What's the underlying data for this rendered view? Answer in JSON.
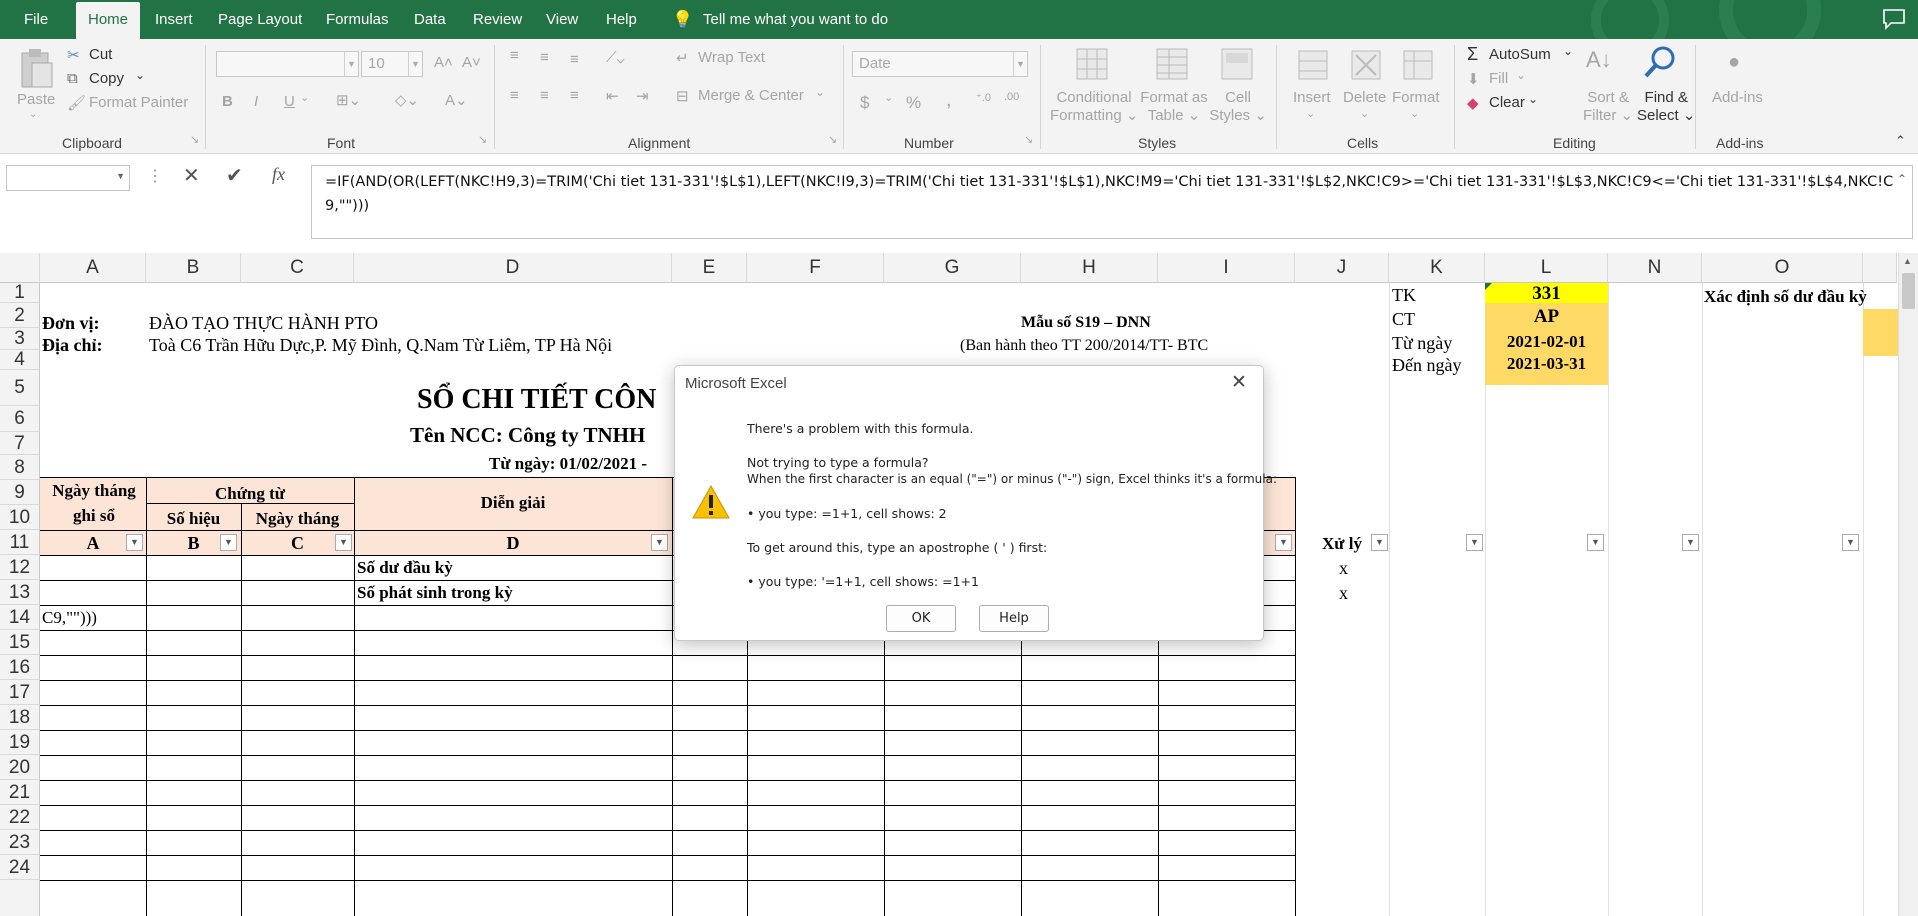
{
  "menu": {
    "tabs": [
      "File",
      "Home",
      "Insert",
      "Page Layout",
      "Formulas",
      "Data",
      "Review",
      "View",
      "Help"
    ],
    "tell_me": "Tell me what you want to do"
  },
  "ribbon": {
    "clipboard": {
      "paste": "Paste",
      "cut": "Cut",
      "copy": "Copy",
      "format_painter": "Format Painter",
      "group": "Clipboard"
    },
    "font": {
      "size": "10",
      "bold": "B",
      "italic": "I",
      "underline": "U",
      "group": "Font"
    },
    "alignment": {
      "wrap": "Wrap Text",
      "merge": "Merge & Center",
      "group": "Alignment"
    },
    "number": {
      "format": "Date",
      "currency": "$",
      "percent": "%",
      "comma": ",",
      "group": "Number"
    },
    "styles": {
      "conditional_1": "Conditional",
      "conditional_2": "Formatting",
      "format_as_1": "Format as",
      "format_as_2": "Table",
      "cell_styles_1": "Cell",
      "cell_styles_2": "Styles",
      "group": "Styles"
    },
    "cells": {
      "insert": "Insert",
      "delete": "Delete",
      "format": "Format",
      "group": "Cells"
    },
    "editing": {
      "autosum": "AutoSum",
      "fill": "Fill",
      "clear": "Clear",
      "sort_1": "Sort &",
      "sort_2": "Filter",
      "find_1": "Find &",
      "find_2": "Select",
      "group": "Editing"
    },
    "addins": {
      "label": "Add-ins",
      "group": "Add-ins"
    }
  },
  "formula_bar": {
    "name_box": "",
    "fx": "fx",
    "formula": "=IF(AND(OR(LEFT(NKC!H9,3)=TRIM('Chi tiet 131-331'!$L$1),LEFT(NKC!I9,3)=TRIM('Chi tiet 131-331'!$L$1),NKC!M9='Chi tiet 131-331'!$L$2,NKC!C9>='Chi tiet 131-331'!$L$3,NKC!C9<='Chi tiet 131-331'!$L$4,NKC!C9,\"\")))"
  },
  "grid": {
    "columns": [
      "A",
      "B",
      "C",
      "D",
      "E",
      "F",
      "G",
      "H",
      "I",
      "J",
      "K",
      "L",
      "N",
      "O"
    ],
    "rows": [
      "1",
      "2",
      "3",
      "4",
      "5",
      "6",
      "7",
      "8",
      "9",
      "10",
      "11",
      "12",
      "13",
      "14",
      "15",
      "16",
      "17",
      "18",
      "19",
      "20",
      "21",
      "22",
      "23",
      "24"
    ],
    "cells": {
      "don_vi_label": "Đơn vị:",
      "don_vi": "ĐÀO TẠO THỰC HÀNH PTO",
      "dia_chi_label": "Địa chỉ:",
      "dia_chi": "Toà C6 Trần Hữu Dực,P. Mỹ Đình, Q.Nam Từ Liêm, TP Hà Nội",
      "mau_so": "Mẫu số S19 – DNN",
      "ban_hanh": "(Ban hành theo TT 200/2014/TT- BTC",
      "title": "SỔ CHI TIẾT CÔN",
      "ncc": "Tên NCC: Công ty TNHH",
      "tu_ngay_line": "Từ ngày: 01/02/2021 -",
      "hdr_ngay_1": "Ngày tháng",
      "hdr_ngay_2": "ghi sổ",
      "hdr_chung_tu": "Chứng từ",
      "hdr_so_hieu": "Số hiệu",
      "hdr_ngay_thang": "Ngày tháng",
      "hdr_dien_giai": "Diễn giải",
      "colA": "A",
      "colB": "B",
      "colC": "C",
      "colD": "D",
      "so_du": "Số dư đầu kỳ",
      "so_phat_sinh": "Số phát sinh trong kỳ",
      "a13": "C9,\"\")))",
      "xu_ly": "Xử lý",
      "x1": "x",
      "x2": "x",
      "tk_label": "TK",
      "tk_value": "331",
      "ct_label": "CT",
      "ct_value": "AP",
      "tu_ngay_label": "Từ ngày",
      "tu_ngay_value": "2021-02-01",
      "den_ngay_label": "Đến ngày",
      "den_ngay_value": "2021-03-31",
      "xac_dinh": "Xác định số dư đầu kỳ"
    }
  },
  "dialog": {
    "title": "Microsoft Excel",
    "line1": "There's a problem with this formula.",
    "line2": "Not trying to type a formula?",
    "line3": "When the first character is an equal (\"=\") or minus (\"-\") sign, Excel thinks it's a formula:",
    "line4": "• you type:   =1+1, cell shows:   2",
    "line5": "To get around this, type an apostrophe ( ' ) first:",
    "line6": "• you type:   '=1+1, cell shows:   =1+1",
    "ok": "OK",
    "help": "Help"
  },
  "colors": {
    "excel_green": "#217346",
    "header_fill": "#fce4d6",
    "yellow": "#ffff00",
    "gold": "#ffd966"
  }
}
